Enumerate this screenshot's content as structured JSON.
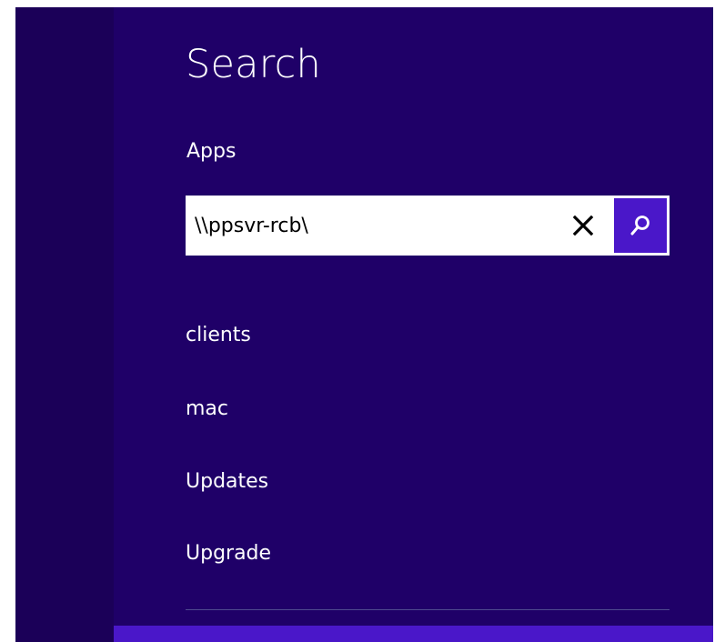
{
  "search_panel": {
    "title": "Search",
    "scope": "Apps",
    "search": {
      "value": "\\\\ppsvr-rcb\\",
      "placeholder": ""
    },
    "results": [
      {
        "label": "clients"
      },
      {
        "label": "mac"
      },
      {
        "label": "Updates"
      },
      {
        "label": "Upgrade"
      }
    ]
  },
  "icons": {
    "clear": "close-icon",
    "search": "search-icon"
  },
  "colors": {
    "panel_bg": "#1f0068",
    "left_strip_bg": "#1b0058",
    "accent": "#4a17c9",
    "text": "#ffffff"
  }
}
